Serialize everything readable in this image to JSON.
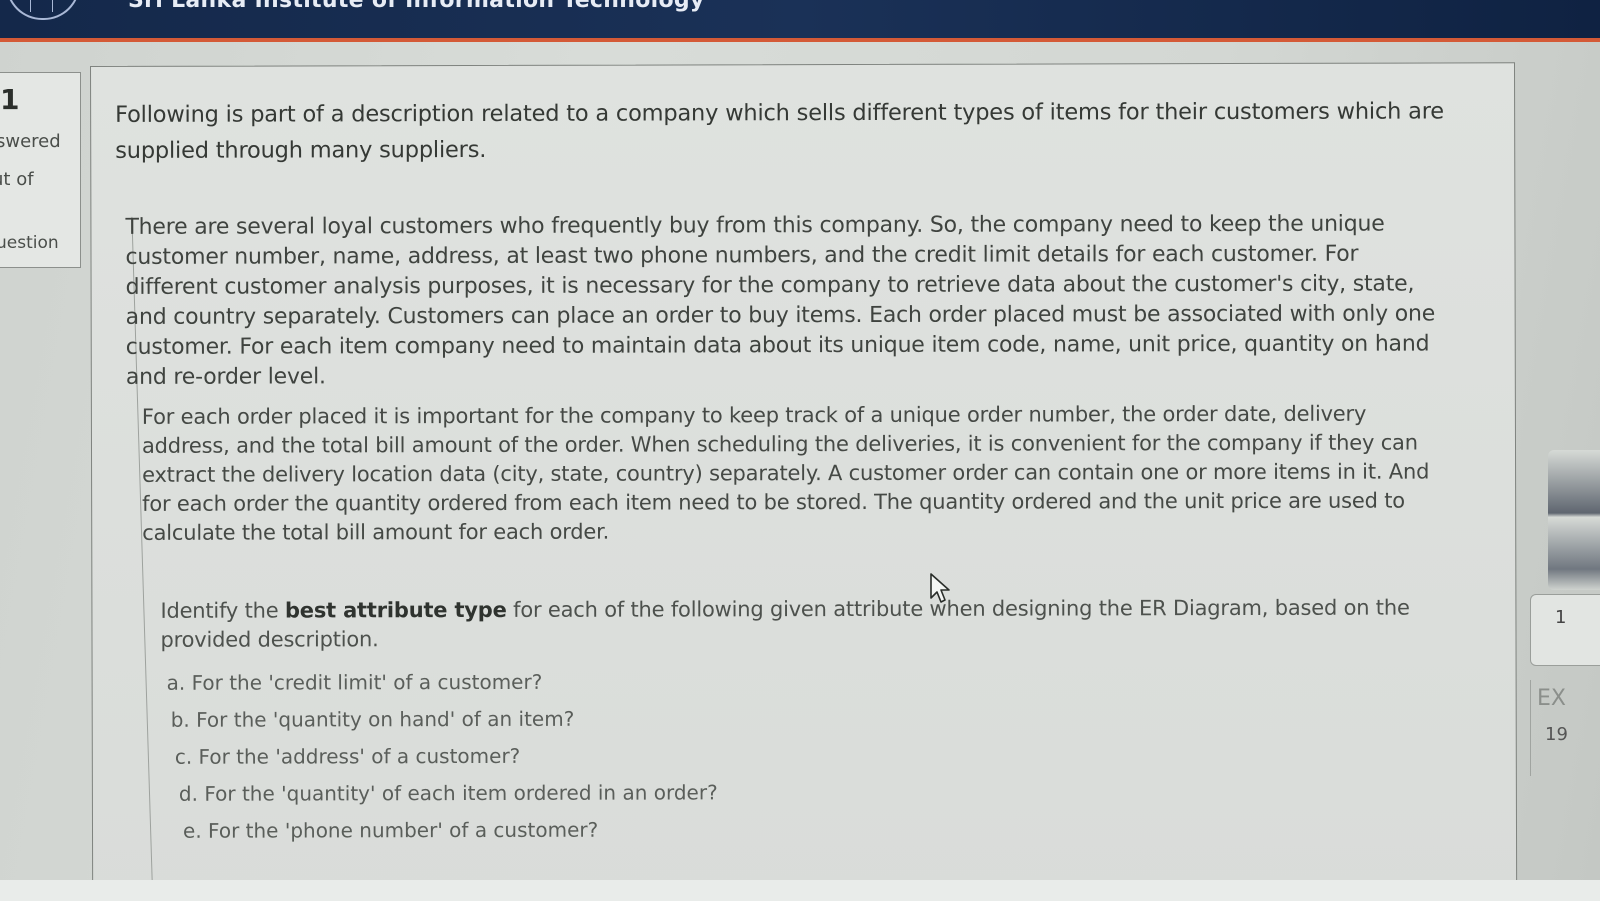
{
  "header": {
    "site_name": "Sri Lanka Institute of Information Technology"
  },
  "question_info": {
    "number": "1",
    "status": "swered",
    "mark": "ut of",
    "flag": "uestion"
  },
  "question": {
    "intro": "Following is part of a description related to a company which sells different types of items for their customers which are supplied through many suppliers.",
    "paragraph_1": "There are several loyal customers who frequently buy from this company. So, the company need to keep the unique customer number, name, address, at least two phone numbers, and the credit limit details for each customer. For different customer analysis purposes, it is necessary for the company to retrieve data about the customer's city, state, and country separately. Customers can place an order to buy items. Each order placed must be associated with only one customer. For each item company need to maintain data about its unique item code, name, unit price, quantity on hand and re-order level.",
    "paragraph_2": "For each order placed it is important for the company to keep track of a unique order number, the order date, delivery address, and the total bill amount of the order. When scheduling the deliveries, it is convenient for the company if they can extract the delivery location data (city, state, country) separately. A customer order can contain one or more items in it. And for each order the quantity ordered from each item need to be stored. The quantity ordered and the unit price are used to calculate the total bill amount for each order.",
    "prompt_prefix": "Identify the ",
    "prompt_bold": "best attribute type",
    "prompt_suffix": " for each of the following given attribute when designing the ER Diagram, based on the provided description.",
    "items": [
      "a. For the 'credit limit' of a customer?",
      "b. For the 'quantity on hand' of an item?",
      "c. For the 'address' of a customer?",
      "d. For the 'quantity' of each item ordered in an order?",
      "e. For the 'phone number' of a customer?"
    ]
  },
  "right_panel": {
    "nav_number": "1",
    "timer_label": "EX",
    "timer_value": "19"
  },
  "colors": {
    "header_bg": "#14284a",
    "header_accent": "#d45a37"
  },
  "icons": {
    "logo": "institute-logo-icon",
    "cursor": "mouse-pointer-icon"
  }
}
